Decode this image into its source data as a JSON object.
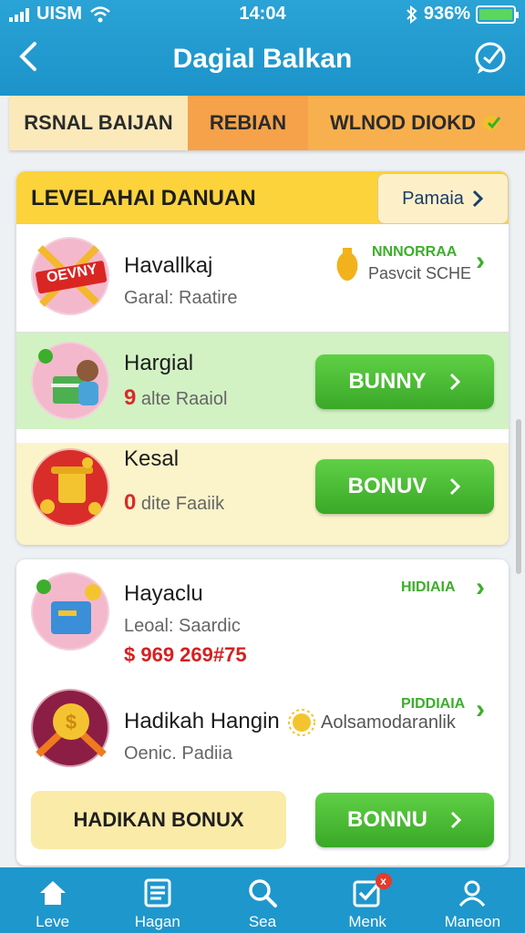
{
  "status": {
    "carrier": "UISM",
    "time": "14:04",
    "battery": "936%"
  },
  "header": {
    "title": "Dagial Balkan"
  },
  "tabs": [
    "RSNAL BAIJAN",
    "REBIAN",
    "WLNOD DIOKD"
  ],
  "card1": {
    "title": "LEVELAHAI DANUAN",
    "head_button": "Pamaia",
    "rows": [
      {
        "badge": "OEVNY",
        "name": "Havallkaj",
        "sub": "Garal: Raatire",
        "right_title": "NNNORRAA",
        "right_sub": "Pasvcit SCHE"
      },
      {
        "name": "Hargial",
        "sub_num": "9",
        "sub": "alte Raaiol",
        "button": "BUNNY"
      },
      {
        "name": "Kesal",
        "sub_num": "0",
        "sub": "dite Faaiik",
        "button": "BONUV"
      }
    ]
  },
  "card2": {
    "rows": [
      {
        "name": "Hayaclu",
        "sub": "Leoal: Saardic",
        "price": "$ 969 269#75",
        "right_title": "HIDIAIA"
      },
      {
        "name": "Hadikah Hangin",
        "right_sub": "Aolsamodaranlik",
        "right_title": "PIDDIAIA",
        "sub": "Oenic. Padiia"
      }
    ],
    "bonus_label": "HADIKAN BONUX",
    "button": "BONNU"
  },
  "bottom_nav": [
    {
      "label": "Leve",
      "icon": "home-icon"
    },
    {
      "label": "Hagan",
      "icon": "list-icon"
    },
    {
      "label": "Sea",
      "icon": "search-icon"
    },
    {
      "label": "Menk",
      "icon": "checkbox-icon",
      "badge": "x"
    },
    {
      "label": "Maneon",
      "icon": "profile-icon"
    }
  ],
  "colors": {
    "header": "#1c93c9",
    "accent_green": "#3dae2b",
    "card_head": "#fcd33b"
  }
}
